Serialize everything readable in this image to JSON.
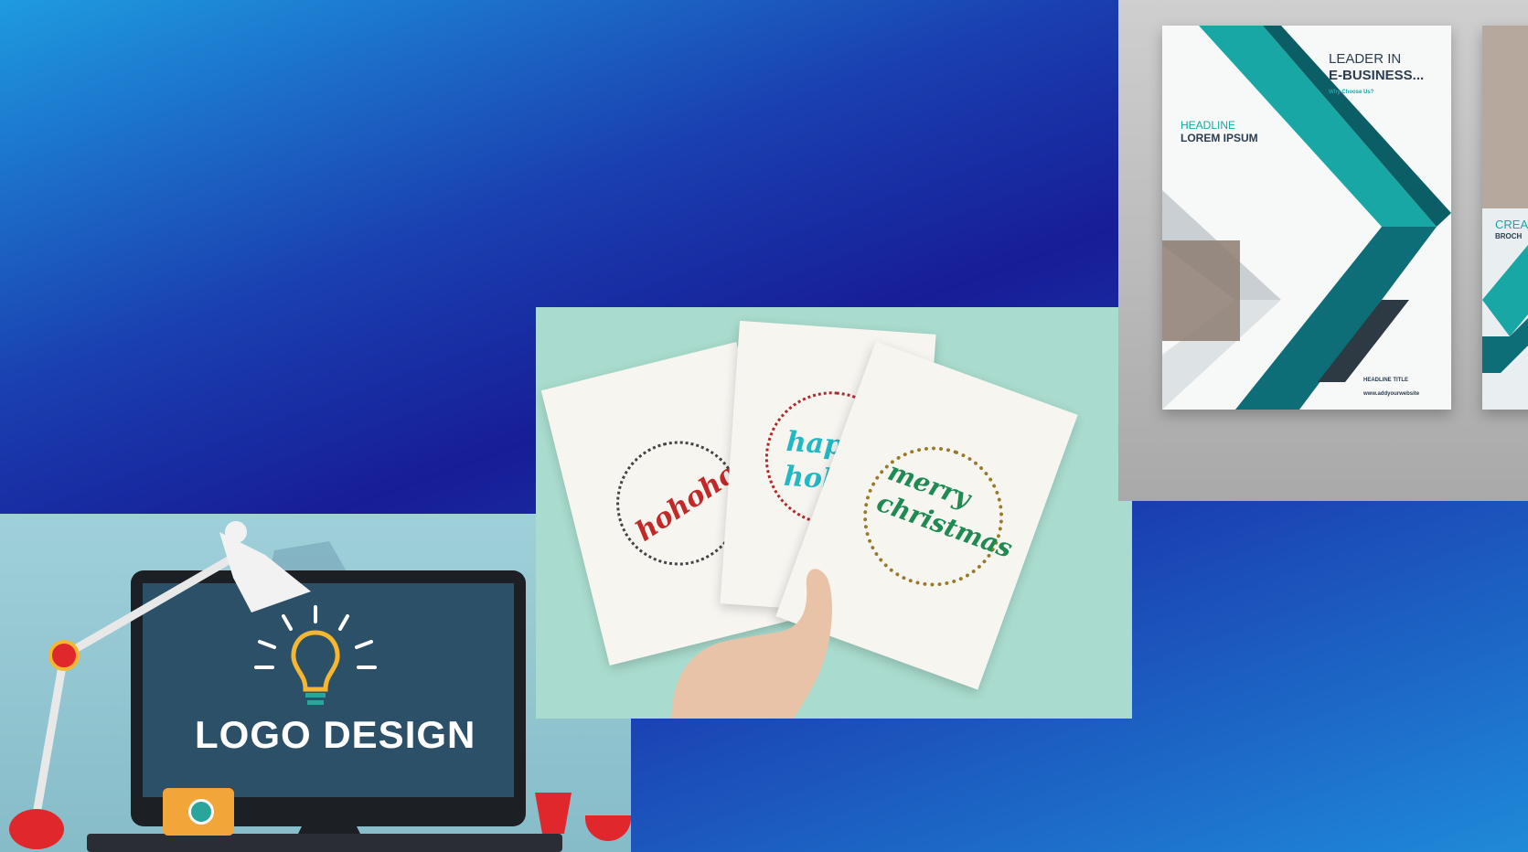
{
  "logo_panel": {
    "title": "LOGO DESIGN",
    "colors": {
      "screen": "#2c5068",
      "lamp": "#e0282c",
      "accent": "#2aa59b"
    }
  },
  "cards_panel": {
    "cards": [
      {
        "text": "hohoho",
        "color": "#c22a2a"
      },
      {
        "text": "happy holid",
        "color": "#22b8c4"
      },
      {
        "text": "merry christmas",
        "color": "#1f8a52"
      }
    ]
  },
  "brochure_panel": {
    "heading_line1": "LEADER IN",
    "heading_line2": "E-BUSINESS...",
    "subheading": "Why Choose Us?",
    "headline_label": "HEADLINE",
    "headline_title": "LOREM IPSUM",
    "footer_title": "HEADLINE TITLE",
    "footer_url": "www.addyourwebsite",
    "second_page_text_1": "CREA",
    "second_page_text_2": "BROCH",
    "colors": {
      "teal": "#18a7a4",
      "dark_teal": "#0e6e78",
      "grey": "#c9cfd2"
    }
  }
}
